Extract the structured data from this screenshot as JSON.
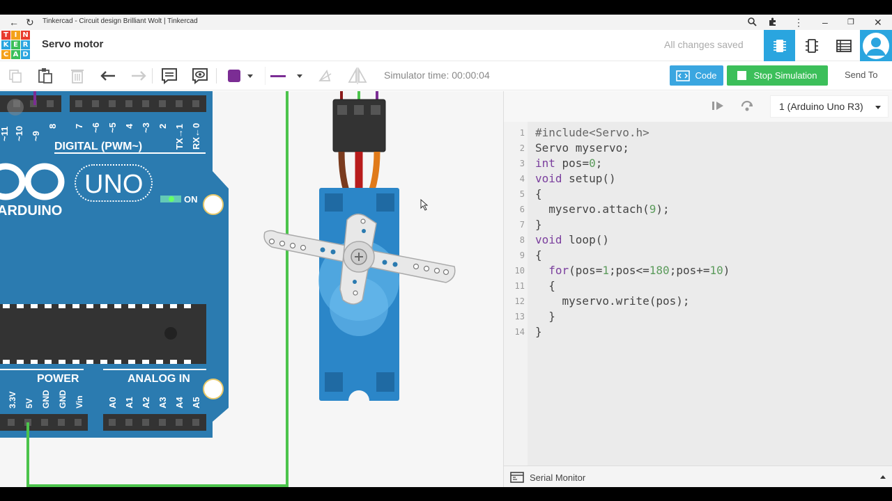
{
  "browser": {
    "tab_title": "Tinkercad - Circuit design Brilliant Wolt | Tinkercad"
  },
  "header": {
    "logo_letters": [
      "T",
      "I",
      "N",
      "K",
      "E",
      "R",
      "C",
      "A",
      "D"
    ],
    "logo_colors": [
      "#e83b2d",
      "#f4a11a",
      "#e83b2d",
      "#2aa5df",
      "#3cbf5a",
      "#2aa5df",
      "#f4a11a",
      "#3cbf5a",
      "#2aa5df"
    ],
    "design_name": "Servo motor",
    "save_status": "All changes saved"
  },
  "toolbar": {
    "simulator_time": "Simulator time: 00:00:04",
    "code_label": "Code",
    "stop_label": "Stop Simulation",
    "send_to_label": "Send To",
    "fill_color": "#7b2d94",
    "line_color": "#7b2d94"
  },
  "board": {
    "digital_label": "DIGITAL (PWM~)",
    "brand": "ARDUINO",
    "model": "UNO",
    "on_label": "ON",
    "power_label": "POWER",
    "analog_label": "ANALOG IN",
    "digital_pins": [
      "~11",
      "~10",
      "~9",
      "8",
      "7",
      "~6",
      "~5",
      "4",
      "~3",
      "2",
      "TX→1",
      "RX←0"
    ],
    "power_pins": [
      "3.3V",
      "5V",
      "GND",
      "GND",
      "Vin"
    ],
    "analog_pins": [
      "A0",
      "A1",
      "A2",
      "A3",
      "A4",
      "A5"
    ]
  },
  "code_panel": {
    "board_selected": "1 (Arduino Uno R3)",
    "line_numbers": [
      "1",
      "2",
      "3",
      "4",
      "5",
      "6",
      "7",
      "8",
      "9",
      "10",
      "11",
      "12",
      "13",
      "14"
    ],
    "serial_monitor_label": "Serial Monitor"
  },
  "colors": {
    "board_blue": "#2b7bb0",
    "code_button": "#3aa6e0",
    "stop_button": "#3cbf5a",
    "active_view": "#2aa5df"
  }
}
